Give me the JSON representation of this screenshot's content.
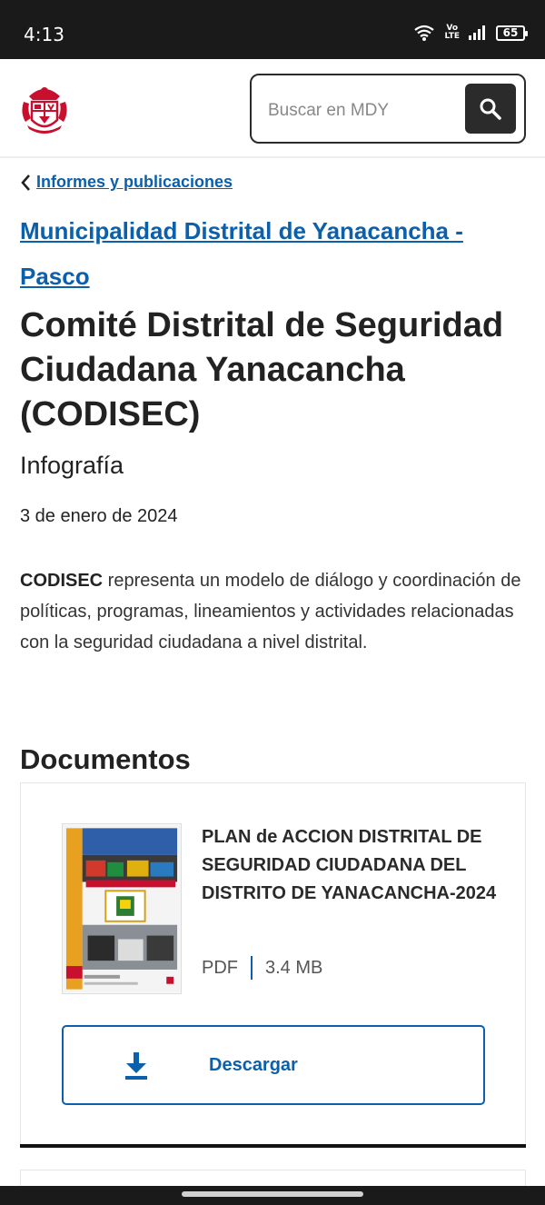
{
  "status": {
    "time": "4:13",
    "volte_top": "Vo",
    "volte_bottom": "LTE",
    "battery": "65"
  },
  "header": {
    "search_placeholder": "Buscar en MDY"
  },
  "breadcrumb": {
    "label": "Informes y publicaciones"
  },
  "article": {
    "organization": "Municipalidad Distrital de Yanacancha - Pasco",
    "title": "Comité Distrital de Seguridad Ciudadana Yanacancha (CODISEC)",
    "category": "Infografía",
    "date": "3 de enero de 2024",
    "description_bold": "CODISEC",
    "description_rest": " representa un modelo de diálogo y coordinación de políticas, programas, lineamientos y actividades relacionadas con la seguridad ciudadana a nivel distrital."
  },
  "documents": {
    "heading": "Documentos",
    "items": [
      {
        "title": "PLAN de ACCION DISTRITAL DE SEGURIDAD CIUDADANA DEL DISTRITO DE YANACANCHA-2024",
        "format": "PDF",
        "size": "3.4 MB",
        "download_label": "Descargar"
      }
    ]
  },
  "colors": {
    "link": "#0b5fab",
    "dark": "#2b2b2b",
    "statusbar": "#1a1a1a",
    "brand_red": "#c8102e"
  },
  "icons": [
    "wifi-icon",
    "signal-icon",
    "battery-icon",
    "peru-coat-of-arms-icon",
    "search-icon",
    "chevron-left-icon",
    "download-icon"
  ]
}
